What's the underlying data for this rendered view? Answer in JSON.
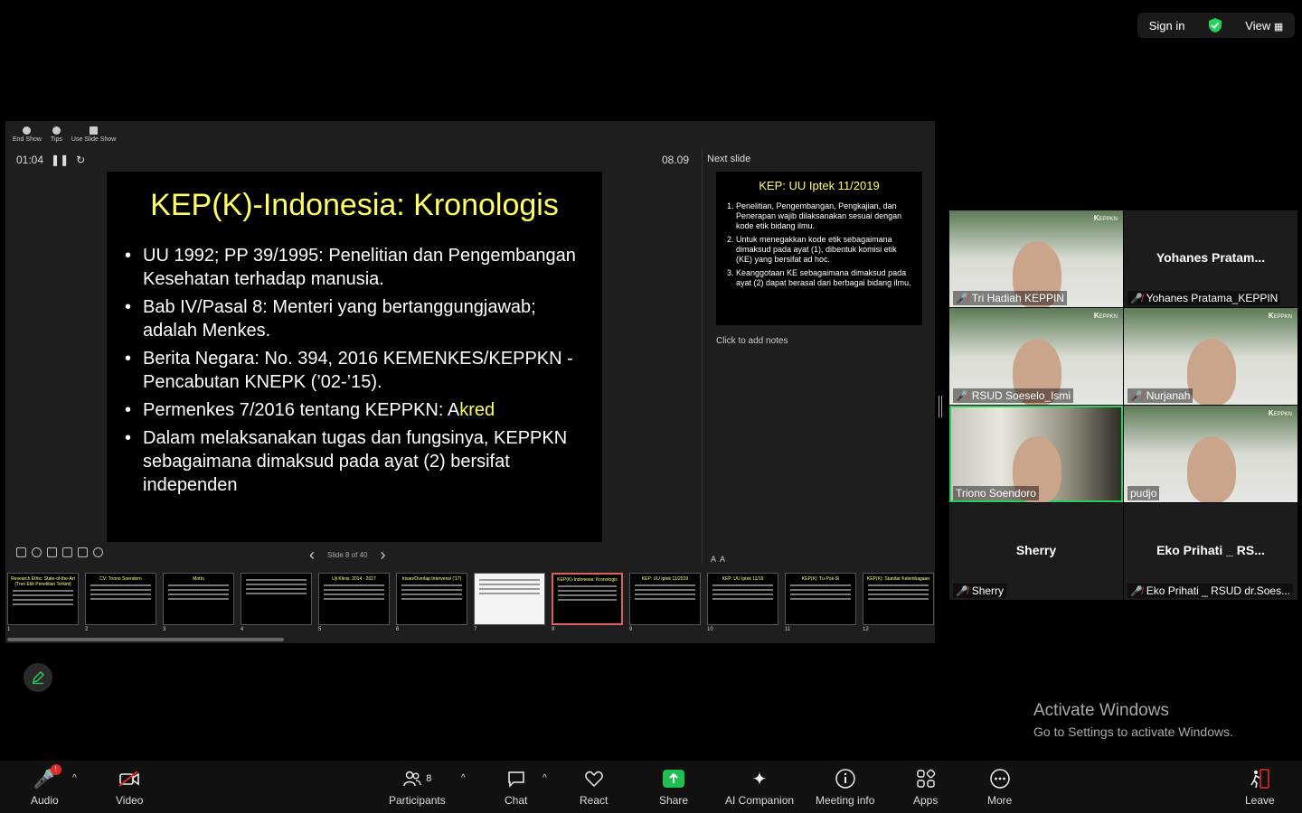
{
  "topbar": {
    "sign_in": "Sign in",
    "view": "View"
  },
  "presenter": {
    "tools": [
      {
        "label": "End Show"
      },
      {
        "label": "Tips"
      },
      {
        "label": "Use Slide Show"
      }
    ],
    "timer": "01:04",
    "clock": "08.09",
    "next_slide_label": "Next slide",
    "notes_placeholder": "Click to add notes",
    "slide_counter": "Slide 8 of 40",
    "current_slide": {
      "title": "KEP(K)-Indonesia: Kronologis",
      "bullets": [
        "UU 1992; PP 39/1995: Penelitian dan Pengembangan Kesehatan terhadap manusia.",
        "Bab IV/Pasal 8: Menteri yang bertanggungjawab; adalah Menkes.",
        "Berita Negara: No. 394, 2016 KEMENKES/KEPPKN - Pencabutan KNEPK (’02-’15).",
        "Permenkes 7/2016 tentang KEPPKN: A",
        "Dalam melaksanakan tugas dan fungsinya, KEPPKN sebagaimana dimaksud pada ayat (2) bersifat independen"
      ],
      "highlight": "kred"
    },
    "next_slide": {
      "title": "KEP: UU Iptek 11/2019",
      "items": [
        "Penelitian, Pengembangan, Pengkajian, dan Penerapan wajib dilaksanakan sesuai dengan kode etik bidang ilmu.",
        "Untuk menegakkan kode etik sebagaimana dimaksud pada ayat (1), dibentuk komisi etik (KE) yang bersifat ad hoc.",
        "Keanggotaan KE sebagaimana dimaksud pada ayat (2) dapat berasal dari berbagai bidang ilmu."
      ]
    },
    "thumbnails": [
      {
        "num": "1",
        "title": "Research Ethic: State-of-the-Art (Tren Etik Penelitian Terkini)"
      },
      {
        "num": "2",
        "title": "CV: Triono Soendoro"
      },
      {
        "num": "3",
        "title": "Motto"
      },
      {
        "num": "4",
        "title": ""
      },
      {
        "num": "5",
        "title": "Uji Klinis: 2014 - 2017"
      },
      {
        "num": "6",
        "title": "Irisan/Overlap Intervensi ('17)"
      },
      {
        "num": "7",
        "title": ""
      },
      {
        "num": "8",
        "title": "KEP(K)-Indonesia: Kronologis"
      },
      {
        "num": "9",
        "title": "KEP: UU Iptek 11/2019"
      },
      {
        "num": "10",
        "title": "KEP: UU Iptek 11/19"
      },
      {
        "num": "11",
        "title": "KEP(K): Tu-Pok-Si"
      },
      {
        "num": "12",
        "title": "KEP(K): Standar Kelembagaan"
      }
    ]
  },
  "participants": [
    {
      "name": "Tri Hadiah KEPPIN",
      "video": true
    },
    {
      "name": "Yohanes Pratama_KEPPIN",
      "display": "Yohanes  Pratam...",
      "video": false
    },
    {
      "name": "RSUD Soeselo_Ismi",
      "video": true
    },
    {
      "name": "Nurjanah",
      "video": true
    },
    {
      "name": "Triono Soendoro",
      "video": true
    },
    {
      "name": "pudjo",
      "video": true
    },
    {
      "name": "Sherry",
      "display": "Sherry",
      "video": false
    },
    {
      "name": "Eko Prihati _ RSUD dr.Soes...",
      "display": "Eko Prihati _ RS...",
      "video": false
    }
  ],
  "watermark": {
    "line1": "Activate Windows",
    "line2": "Go to Settings to activate Windows."
  },
  "toolbar": {
    "audio": "Audio",
    "audio_badge": "!",
    "video": "Video",
    "participants": "Participants",
    "participants_count": "8",
    "chat": "Chat",
    "react": "React",
    "share": "Share",
    "ai": "AI Companion",
    "meeting_info": "Meeting info",
    "apps": "Apps",
    "more": "More",
    "leave": "Leave"
  },
  "colors": {
    "accent_green": "#23d35c",
    "share_green": "#1fbf52",
    "slide_yellow": "#ffff66",
    "mute_red": "#e04040"
  }
}
